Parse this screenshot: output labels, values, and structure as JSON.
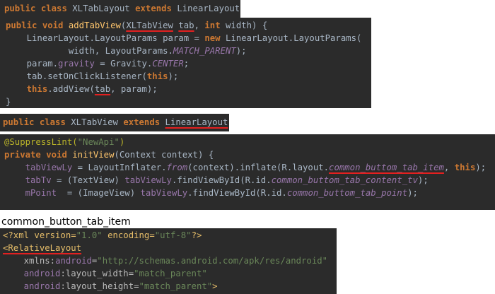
{
  "block1_header": {
    "kw1": "public",
    "kw2": "class",
    "name": "XLTabLayout",
    "kw3": "extends",
    "base": "LinearLayout"
  },
  "block1": {
    "l1": {
      "kw1": "public",
      "kw2": "void",
      "method": "addTabView",
      "open": "(",
      "type": "XLTabView",
      "param": "tab",
      "sep": ", ",
      "kw3": "int",
      "rest": " width) {"
    },
    "l2": {
      "a": "LinearLayout.LayoutParams param = ",
      "kw": "new",
      "b": " LinearLayout.LayoutParams("
    },
    "l3": {
      "a": "width, LayoutParams.",
      "c": "MATCH_PARENT",
      "b": ");"
    },
    "l4": {
      "a": "param.",
      "f": "gravity",
      "b": " = Gravity.",
      "c": "CENTER",
      "d": ";"
    },
    "l5": {
      "a": "tab.setOnClickListener(",
      "kw": "this",
      "b": ");"
    },
    "l6": {
      "kw": "this",
      "a": ".addView(",
      "ul": "tab",
      "b": ", param);"
    },
    "l7": "}"
  },
  "block2_header": {
    "kw1": "public",
    "kw2": "class",
    "name": "XLTabView",
    "kw3": "extends",
    "base": "LinearLayout"
  },
  "block2": {
    "l1": {
      "ann": "@SuppressLint(",
      "str": "\"NewApi\"",
      "close": ")"
    },
    "l2": {
      "kw1": "private",
      "kw2": "void",
      "method": "initView",
      "rest": "(Context context) {"
    },
    "l3": {
      "f1": "tabViewLy",
      "a": " = LayoutInflater.",
      "i1": "from",
      "b": "(context).inflate(R.layout.",
      "i2": "common_buttom_tab_item",
      "c": ", ",
      "kw": "this",
      "d": ");"
    },
    "l4": {
      "f1": "tabTv",
      "a": " = (TextView) ",
      "f2": "tabViewLy",
      "b": ".findViewById(R.id.",
      "i": "common_buttom_tab_content_tv",
      "c": ");"
    },
    "l5": {
      "f1": "mPoint",
      "a": "  = (ImageView) ",
      "f2": "tabViewLy",
      "b": ".findViewById(R.id.",
      "i": "common_buttom_tab_point",
      "c": ");"
    }
  },
  "caption": "common_button_tab_item",
  "block3": {
    "l1": {
      "a": "<?xml version=",
      "s1": "\"1.0\"",
      "b": " encoding=",
      "s2": "\"utf-8\"",
      "c": "?>"
    },
    "l2": {
      "tag": "<RelativeLayout"
    },
    "l3": {
      "ns": "xmlns",
      "colon": ":",
      "attr": "android",
      "eq": "=",
      "val": "\"http://schemas.android.com/apk/res/android\""
    },
    "l4": {
      "ns": "android",
      "colon": ":",
      "attr": "layout_width",
      "eq": "=",
      "val": "\"match_parent\""
    },
    "l5": {
      "ns": "android",
      "colon": ":",
      "attr": "layout_height",
      "eq": "=",
      "val": "\"match_parent\"",
      "end": ">"
    }
  }
}
